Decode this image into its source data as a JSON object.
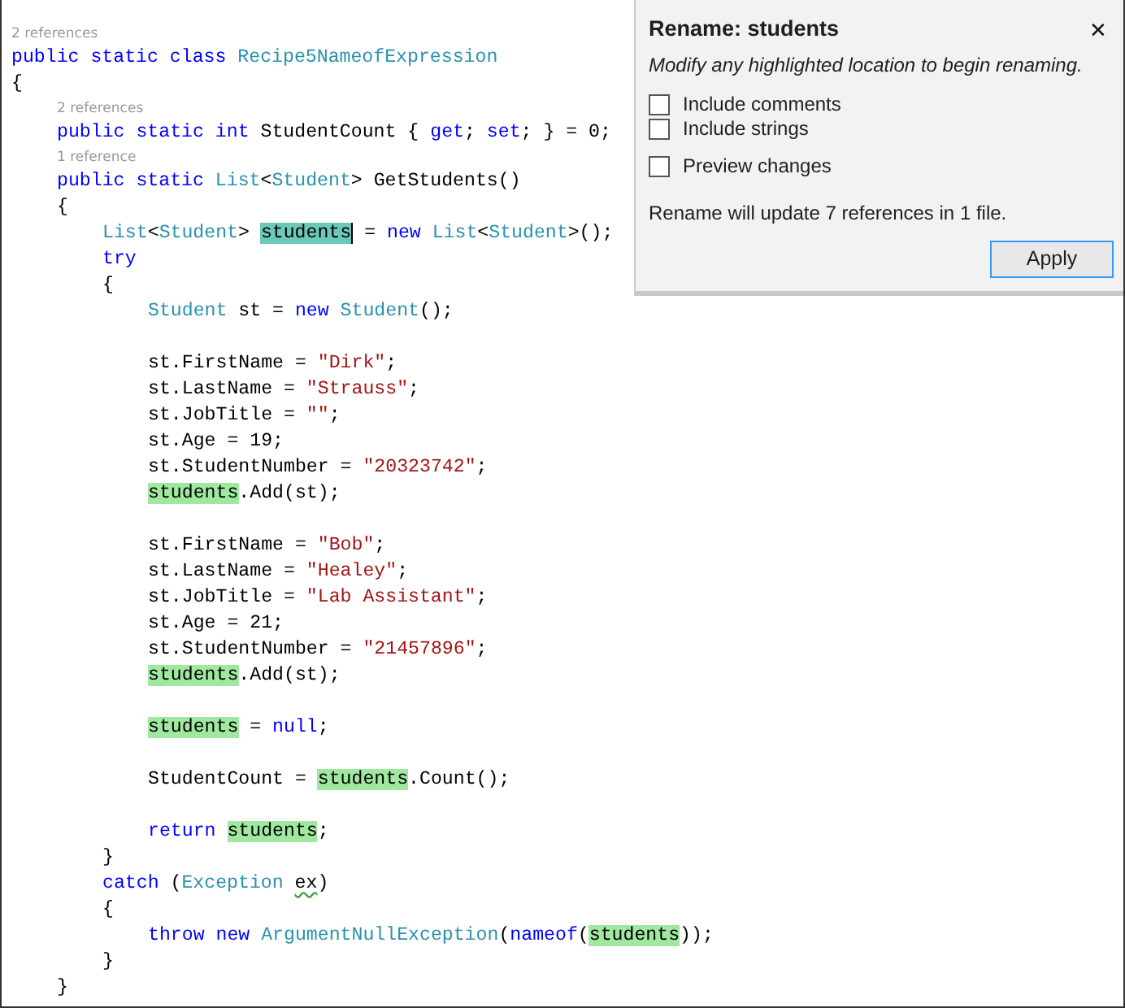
{
  "code_lines": [
    {
      "kind": "lens",
      "text": "2 references"
    },
    {
      "kind": "code",
      "tokens": [
        {
          "text": "public static class ",
          "kind": "keyword"
        },
        {
          "text": "Recipe5NameofExpression",
          "kind": "type"
        }
      ]
    },
    {
      "kind": "code",
      "tokens": [
        {
          "text": "{",
          "kind": "plain"
        }
      ],
      "children": [
        {
          "kind": "lens",
          "text": "2 references"
        },
        {
          "kind": "code",
          "tokens": [
            {
              "text": "public static int ",
              "kind": "keyword"
            },
            {
              "text": "StudentCount { ",
              "kind": "plain"
            },
            {
              "text": "get",
              "kind": "keyword"
            },
            {
              "text": "; ",
              "kind": "plain"
            },
            {
              "text": "set",
              "kind": "keyword"
            },
            {
              "text": "; } = 0;",
              "kind": "plain"
            }
          ]
        },
        {
          "kind": "lens",
          "text": "1 reference"
        },
        {
          "kind": "code",
          "tokens": [
            {
              "text": "public static ",
              "kind": "keyword"
            },
            {
              "text": "List",
              "kind": "type"
            },
            {
              "text": "<",
              "kind": "plain"
            },
            {
              "text": "Student",
              "kind": "type"
            },
            {
              "text": "> GetStudents()",
              "kind": "plain"
            }
          ]
        },
        {
          "kind": "code",
          "tokens": [
            {
              "text": "{",
              "kind": "plain"
            }
          ],
          "children": [
            {
              "kind": "code",
              "tokens": [
                {
                  "text": "List",
                  "kind": "type"
                },
                {
                  "text": "<",
                  "kind": "plain"
                },
                {
                  "text": "Student",
                  "kind": "type"
                },
                {
                  "text": "> ",
                  "kind": "plain"
                },
                {
                  "text": "students",
                  "kind": "rename-active"
                },
                {
                  "text": " = ",
                  "kind": "plain"
                },
                {
                  "text": "new ",
                  "kind": "keyword"
                },
                {
                  "text": "List",
                  "kind": "type"
                },
                {
                  "text": "<",
                  "kind": "plain"
                },
                {
                  "text": "Student",
                  "kind": "type"
                },
                {
                  "text": ">();",
                  "kind": "plain"
                }
              ]
            },
            {
              "kind": "code",
              "tokens": [
                {
                  "text": "try",
                  "kind": "keyword"
                }
              ]
            },
            {
              "kind": "code",
              "tokens": [
                {
                  "text": "{",
                  "kind": "plain"
                }
              ],
              "children": [
                {
                  "kind": "code",
                  "tokens": [
                    {
                      "text": "Student",
                      "kind": "type"
                    },
                    {
                      "text": " st = ",
                      "kind": "plain"
                    },
                    {
                      "text": "new ",
                      "kind": "keyword"
                    },
                    {
                      "text": "Student",
                      "kind": "type"
                    },
                    {
                      "text": "();",
                      "kind": "plain"
                    }
                  ]
                },
                {
                  "kind": "blank"
                },
                {
                  "kind": "code",
                  "tokens": [
                    {
                      "text": "st.FirstName = ",
                      "kind": "plain"
                    },
                    {
                      "text": "\"Dirk\"",
                      "kind": "string"
                    },
                    {
                      "text": ";",
                      "kind": "plain"
                    }
                  ]
                },
                {
                  "kind": "code",
                  "tokens": [
                    {
                      "text": "st.LastName = ",
                      "kind": "plain"
                    },
                    {
                      "text": "\"Strauss\"",
                      "kind": "string"
                    },
                    {
                      "text": ";",
                      "kind": "plain"
                    }
                  ]
                },
                {
                  "kind": "code",
                  "tokens": [
                    {
                      "text": "st.JobTitle = ",
                      "kind": "plain"
                    },
                    {
                      "text": "\"\"",
                      "kind": "string"
                    },
                    {
                      "text": ";",
                      "kind": "plain"
                    }
                  ]
                },
                {
                  "kind": "code",
                  "tokens": [
                    {
                      "text": "st.Age = 19;",
                      "kind": "plain"
                    }
                  ]
                },
                {
                  "kind": "code",
                  "tokens": [
                    {
                      "text": "st.StudentNumber = ",
                      "kind": "plain"
                    },
                    {
                      "text": "\"20323742\"",
                      "kind": "string"
                    },
                    {
                      "text": ";",
                      "kind": "plain"
                    }
                  ]
                },
                {
                  "kind": "code",
                  "tokens": [
                    {
                      "text": "students",
                      "kind": "rename"
                    },
                    {
                      "text": ".Add(st);",
                      "kind": "plain"
                    }
                  ]
                },
                {
                  "kind": "blank"
                },
                {
                  "kind": "code",
                  "tokens": [
                    {
                      "text": "st.FirstName = ",
                      "kind": "plain"
                    },
                    {
                      "text": "\"Bob\"",
                      "kind": "string"
                    },
                    {
                      "text": ";",
                      "kind": "plain"
                    }
                  ]
                },
                {
                  "kind": "code",
                  "tokens": [
                    {
                      "text": "st.LastName = ",
                      "kind": "plain"
                    },
                    {
                      "text": "\"Healey\"",
                      "kind": "string"
                    },
                    {
                      "text": ";",
                      "kind": "plain"
                    }
                  ]
                },
                {
                  "kind": "code",
                  "tokens": [
                    {
                      "text": "st.JobTitle = ",
                      "kind": "plain"
                    },
                    {
                      "text": "\"Lab Assistant\"",
                      "kind": "string"
                    },
                    {
                      "text": ";",
                      "kind": "plain"
                    }
                  ]
                },
                {
                  "kind": "code",
                  "tokens": [
                    {
                      "text": "st.Age = 21;",
                      "kind": "plain"
                    }
                  ]
                },
                {
                  "kind": "code",
                  "tokens": [
                    {
                      "text": "st.StudentNumber = ",
                      "kind": "plain"
                    },
                    {
                      "text": "\"21457896\"",
                      "kind": "string"
                    },
                    {
                      "text": ";",
                      "kind": "plain"
                    }
                  ]
                },
                {
                  "kind": "code",
                  "tokens": [
                    {
                      "text": "students",
                      "kind": "rename"
                    },
                    {
                      "text": ".Add(st);",
                      "kind": "plain"
                    }
                  ]
                },
                {
                  "kind": "blank"
                },
                {
                  "kind": "code",
                  "tokens": [
                    {
                      "text": "students",
                      "kind": "rename"
                    },
                    {
                      "text": " = ",
                      "kind": "plain"
                    },
                    {
                      "text": "null",
                      "kind": "keyword"
                    },
                    {
                      "text": ";",
                      "kind": "plain"
                    }
                  ]
                },
                {
                  "kind": "blank"
                },
                {
                  "kind": "code",
                  "tokens": [
                    {
                      "text": "StudentCount = ",
                      "kind": "plain"
                    },
                    {
                      "text": "students",
                      "kind": "rename"
                    },
                    {
                      "text": ".Count();",
                      "kind": "plain"
                    }
                  ]
                },
                {
                  "kind": "blank"
                },
                {
                  "kind": "code",
                  "tokens": [
                    {
                      "text": "return ",
                      "kind": "keyword"
                    },
                    {
                      "text": "students",
                      "kind": "rename"
                    },
                    {
                      "text": ";",
                      "kind": "plain"
                    }
                  ]
                }
              ]
            },
            {
              "kind": "code",
              "tokens": [
                {
                  "text": "}",
                  "kind": "plain"
                }
              ]
            },
            {
              "kind": "code",
              "tokens": [
                {
                  "text": "catch ",
                  "kind": "keyword"
                },
                {
                  "text": "(",
                  "kind": "plain"
                },
                {
                  "text": "Exception ",
                  "kind": "type"
                },
                {
                  "text": "ex",
                  "kind": "warning"
                },
                {
                  "text": ")",
                  "kind": "plain"
                }
              ]
            },
            {
              "kind": "code",
              "tokens": [
                {
                  "text": "{",
                  "kind": "plain"
                }
              ],
              "children": [
                {
                  "kind": "code",
                  "tokens": [
                    {
                      "text": "throw new ",
                      "kind": "keyword"
                    },
                    {
                      "text": "ArgumentNullException",
                      "kind": "type"
                    },
                    {
                      "text": "(",
                      "kind": "plain"
                    },
                    {
                      "text": "nameof",
                      "kind": "keyword"
                    },
                    {
                      "text": "(",
                      "kind": "plain"
                    },
                    {
                      "text": "students",
                      "kind": "rename"
                    },
                    {
                      "text": "));",
                      "kind": "plain"
                    }
                  ]
                }
              ]
            },
            {
              "kind": "code",
              "tokens": [
                {
                  "text": "}",
                  "kind": "plain"
                }
              ]
            }
          ]
        },
        {
          "kind": "code",
          "tokens": [
            {
              "text": "}",
              "kind": "plain"
            }
          ]
        }
      ]
    }
  ],
  "rename_panel": {
    "title": "Rename: students",
    "close": "✕",
    "hint": "Modify any highlighted location to begin renaming.",
    "options": [
      {
        "label": "Include comments",
        "checked": false
      },
      {
        "label": "Include strings",
        "checked": false
      },
      {
        "label": "Preview changes",
        "checked": false
      }
    ],
    "summary": "Rename will update 7 references in 1 file.",
    "button": "Apply"
  }
}
